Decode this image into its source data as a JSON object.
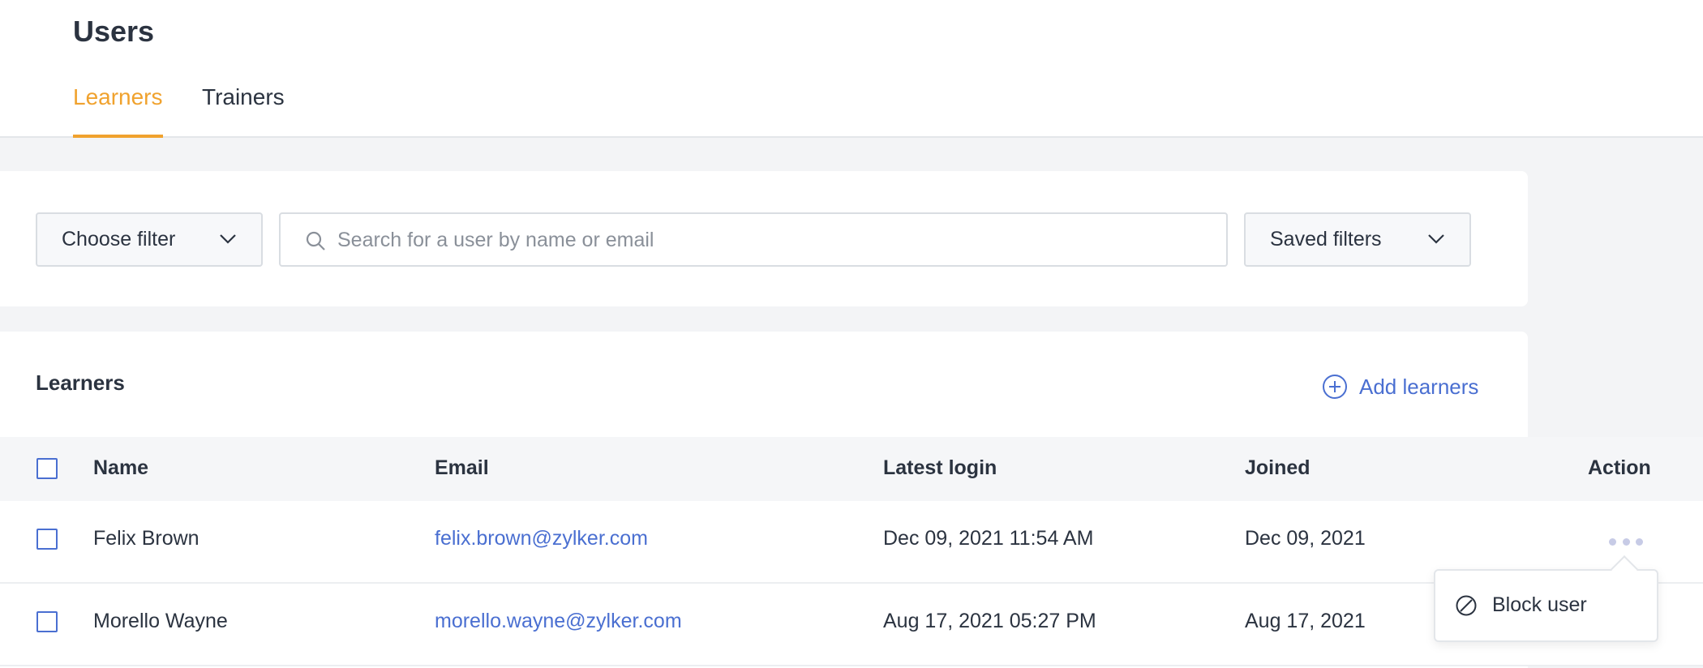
{
  "page": {
    "title": "Users"
  },
  "tabs": [
    {
      "label": "Learners",
      "active": true
    },
    {
      "label": "Trainers",
      "active": false
    }
  ],
  "filters": {
    "choose_filter": "Choose filter",
    "search_placeholder": "Search for a user by name or email",
    "saved_filters": "Saved filters"
  },
  "learners_card": {
    "title": "Learners",
    "add_label": "Add learners"
  },
  "table": {
    "columns": [
      "Name",
      "Email",
      "Latest login",
      "Joined",
      "Action"
    ],
    "rows": [
      {
        "name": "Felix Brown",
        "email": "felix.brown@zylker.com",
        "latest_login": "Dec 09, 2021 11:54 AM",
        "joined": "Dec 09, 2021"
      },
      {
        "name": "Morello Wayne",
        "email": "morello.wayne@zylker.com",
        "latest_login": "Aug 17, 2021 05:27 PM",
        "joined": "Aug 17, 2021"
      }
    ]
  },
  "action_menu": {
    "items": [
      {
        "label": "Block user",
        "icon": "block-icon"
      }
    ]
  },
  "icons": {
    "search": "search-icon",
    "chevron": "chevron-down-icon",
    "add": "plus-circle-icon",
    "more": "more-horizontal-icon"
  },
  "colors": {
    "accent": "#f0a22e",
    "link": "#4a6fd1",
    "text": "#2b3340",
    "background": "#f3f4f6"
  }
}
